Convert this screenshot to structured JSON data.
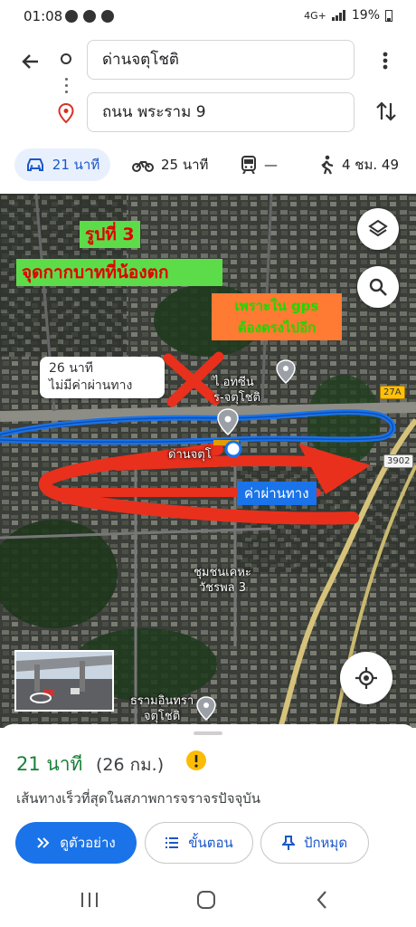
{
  "status": {
    "time": "01:08",
    "network": "4G+",
    "battery": "19%"
  },
  "route": {
    "origin": "ด่านจตุโชติ",
    "destination": "ถนน พระราม 9"
  },
  "modes": [
    {
      "icon": "car-icon",
      "label": "21 นาที"
    },
    {
      "icon": "motorcycle-icon",
      "label": "25 นาที"
    },
    {
      "icon": "transit-icon",
      "label": "—"
    },
    {
      "icon": "walk-icon",
      "label": "4 ชม. 49"
    }
  ],
  "map": {
    "annotation_title": "รูปที่ 3",
    "annotation_subtitle": "จุดกากบาทที่น้องตก",
    "annotation_note_line1": "เพราะใน gps",
    "annotation_note_line2": "ต้องตรงไปอีก",
    "alt_route_time": "26 นาที",
    "alt_route_toll": "ไม่มีค่าผ่านทาง",
    "toll_label": "ค่าผ่านทาง",
    "place_tollgate": "ด่านจตุโ",
    "place_poi_line1": "ไ     อทซีน",
    "place_poi_line2": "ร-จตุโชติ",
    "place_village_line1": "ชุมชนเคหะ",
    "place_village_line2": "วัชรพล 3",
    "place_bottom_line1": "ธรามอินทรา",
    "place_bottom_line2": "จตุโชติ",
    "road_27a": "27A",
    "road_3902": "3902"
  },
  "trip": {
    "time": "21 นาที",
    "distance": "(26 กม.)",
    "description": "เส้นทางเร็วที่สุดในสภาพการจราจรปัจจุบัน",
    "preview_label": "ดูตัวอย่าง",
    "steps_label": "ขั้นตอน",
    "pin_label": "ปักหมุด"
  },
  "colors": {
    "route_blue": "#1a73e8",
    "annotation_red": "#e8301c",
    "trip_green": "#188038"
  }
}
